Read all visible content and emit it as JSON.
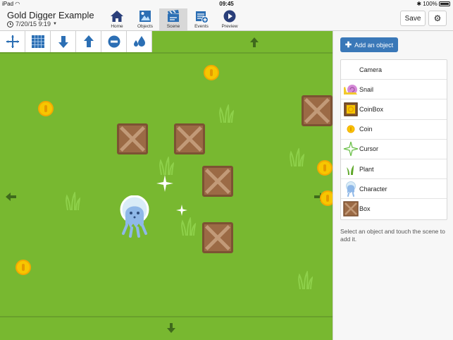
{
  "status_bar": {
    "device": "iPad",
    "time": "09:45",
    "battery": "100%"
  },
  "header": {
    "title": "Gold Digger Example",
    "date": "7/20/15 9:19",
    "save_label": "Save",
    "nav": [
      {
        "label": "Home",
        "icon": "home-icon"
      },
      {
        "label": "Objects",
        "icon": "objects-icon"
      },
      {
        "label": "Scene",
        "icon": "scene-icon",
        "active": true
      },
      {
        "label": "Events",
        "icon": "events-icon"
      },
      {
        "label": "Preview",
        "icon": "play-icon"
      }
    ]
  },
  "toolbar": {
    "tools": [
      {
        "icon": "move-cross-icon"
      },
      {
        "icon": "grid-icon"
      },
      {
        "icon": "send-backward-icon"
      },
      {
        "icon": "bring-forward-icon"
      },
      {
        "icon": "delete-icon"
      },
      {
        "icon": "physics-drop-icon"
      }
    ]
  },
  "panel": {
    "add_button": "Add an object",
    "objects": [
      {
        "label": "Camera",
        "icon": ""
      },
      {
        "label": "Snail",
        "icon": "snail-icon"
      },
      {
        "label": "CoinBox",
        "icon": "coinbox-icon"
      },
      {
        "label": "Coin",
        "icon": "coin-icon"
      },
      {
        "label": "Cursor",
        "icon": "cursor-icon"
      },
      {
        "label": "Plant",
        "icon": "plant-icon"
      },
      {
        "label": "Character",
        "icon": "character-icon"
      },
      {
        "label": "Box",
        "icon": "box-icon"
      }
    ],
    "help_text": "Select an object and touch the scene to add it."
  },
  "colors": {
    "accent": "#3a78b8",
    "grass": "#78b830",
    "coin": "#f7c600",
    "box": "#9b6a45"
  }
}
